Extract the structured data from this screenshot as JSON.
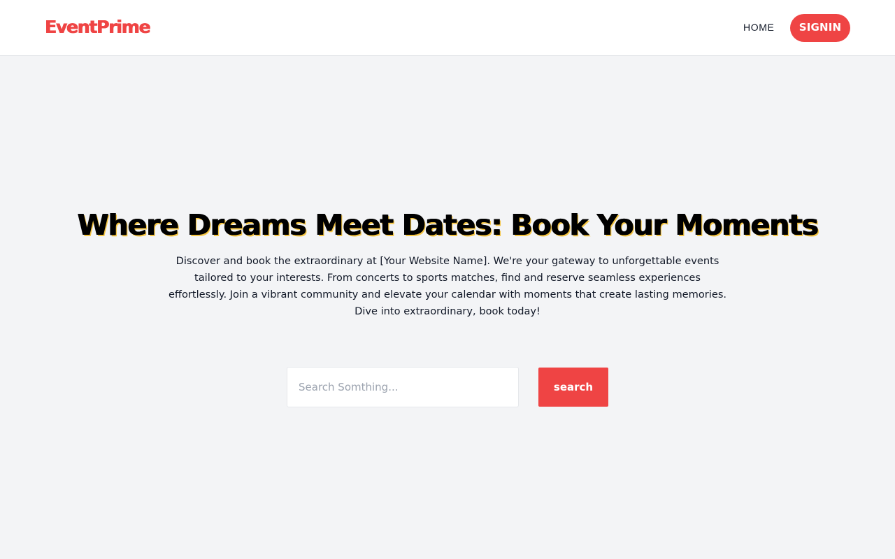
{
  "brand": {
    "name": "EventPrime",
    "accent_color": "#ef4444"
  },
  "nav": {
    "home_label": "HOME",
    "signin_label": "SIGNIN"
  },
  "hero": {
    "title": "Where Dreams Meet Dates: Book Your Moments",
    "description": "Discover and book the extraordinary at [Your Website Name]. We're your gateway to unforgettable events tailored to your interests. From concerts to sports matches, find and reserve seamless experiences effortlessly. Join a vibrant community and elevate your calendar with moments that create lasting memories. Dive into extraordinary, book today!"
  },
  "search": {
    "placeholder": "Search Somthing...",
    "value": "",
    "button_label": "search"
  }
}
